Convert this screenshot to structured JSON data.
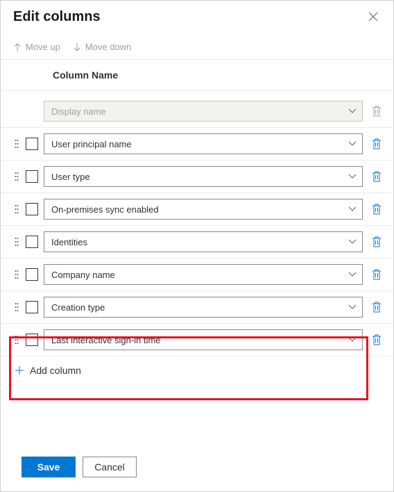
{
  "panel": {
    "title": "Edit columns"
  },
  "toolbar": {
    "move_up": "Move up",
    "move_down": "Move down"
  },
  "header": {
    "column_name": "Column Name"
  },
  "rows": [
    {
      "label": "Display name",
      "locked": true
    },
    {
      "label": "User principal name",
      "locked": false
    },
    {
      "label": "User type",
      "locked": false
    },
    {
      "label": "On-premises sync enabled",
      "locked": false
    },
    {
      "label": "Identities",
      "locked": false
    },
    {
      "label": "Company name",
      "locked": false
    },
    {
      "label": "Creation type",
      "locked": false
    },
    {
      "label": "Last interactive sign-in time",
      "locked": false
    }
  ],
  "actions": {
    "add_column": "Add column",
    "save": "Save",
    "cancel": "Cancel"
  },
  "colors": {
    "primary": "#0078d4",
    "highlight": "#e81123"
  }
}
